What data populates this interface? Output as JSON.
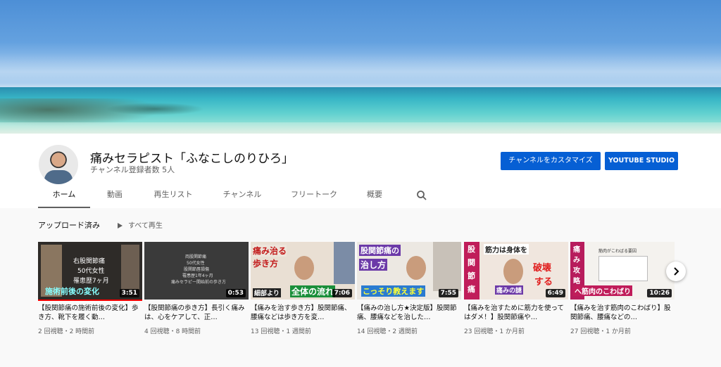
{
  "channel": {
    "name": "痛みセラピスト「ふなこしのりひろ」",
    "subscribers": "チャンネル登録者数 5人"
  },
  "buttons": {
    "customize": "チャンネルをカスタマイズ",
    "studio": "YOUTUBE STUDIO"
  },
  "tabs": [
    "ホーム",
    "動画",
    "再生リスト",
    "チャンネル",
    "フリートーク",
    "概要"
  ],
  "section": {
    "title": "アップロード済み",
    "play_all": "すべて再生"
  },
  "colors": {
    "accent": "#065fd4",
    "progress": "#ff0000"
  },
  "videos": [
    {
      "duration": "3:51",
      "title": "【股関節痛の施術前後の変化】歩き方、靴下を履く動…",
      "meta": "2 回視聴・2 時間前",
      "thumb_text": [
        "右股関節痛",
        "50代女性",
        "罹患歴7ヶ月",
        "施術前後の変化"
      ]
    },
    {
      "duration": "0:53",
      "title": "【股関節痛の歩き方】長引く痛みは、心をケアして、正…",
      "meta": "4 回視聴・8 時間前",
      "thumb_text": [
        "両股関節痛",
        "50代女性",
        "股関節唇損傷",
        "罹患歴1年4ヶ月",
        "痛みセラピー開始前の歩き方"
      ]
    },
    {
      "duration": "7:06",
      "title": "【痛みを治す歩き方】股関節痛、腰痛などは歩き方を変…",
      "meta": "13 回視聴・1 週間前",
      "thumb_text": [
        "痛み治る",
        "歩き方",
        "細部より",
        "全体の流れ"
      ]
    },
    {
      "duration": "7:55",
      "title": "【痛みの治し方★決定版】股関節痛、腰痛などを治した…",
      "meta": "14 回視聴・2 週間前",
      "thumb_text": [
        "股関節痛の",
        "治し方",
        "こっそり教えます"
      ]
    },
    {
      "duration": "6:49",
      "title": "【痛みを治すために筋力を使ってはダメ！】股関節痛や…",
      "meta": "23 回視聴・1 か月前",
      "thumb_text": [
        "股",
        "関",
        "節",
        "痛",
        "筋力は身体を",
        "破壊",
        "する",
        "痛みの謎"
      ]
    },
    {
      "duration": "10:26",
      "title": "【痛みを治す筋肉のこわばり】股関節痛、腰痛などの…",
      "meta": "27 回視聴・1 か月前",
      "thumb_text": [
        "痛",
        "み",
        "攻",
        "略",
        "へ筋肉のこわばり",
        "筋肉がこわばる要因"
      ]
    }
  ],
  "icons": {
    "search": "search-icon",
    "play": "play-icon",
    "next": "chevron-right-icon"
  }
}
